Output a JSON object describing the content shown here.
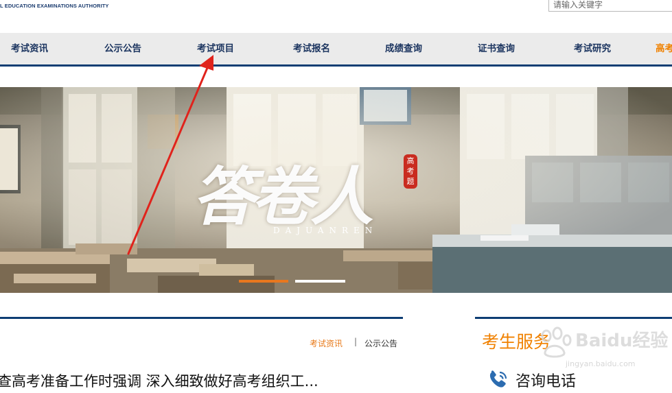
{
  "header": {
    "authority_text": "L EDUCATION EXAMINATIONS AUTHORITY",
    "search_placeholder": "请输入关键字"
  },
  "nav": {
    "items": [
      "考试资讯",
      "公示公告",
      "考试项目",
      "考试报名",
      "成绩查询",
      "证书查询",
      "考试研究",
      "高考"
    ],
    "highlighted_index": 7,
    "highlight_color": "#f08100",
    "bar_color": "#0d3d73"
  },
  "banner": {
    "title": "答卷人",
    "seal_text": "高考题",
    "subtitle": "DAJUANREN",
    "slide_indicators": {
      "count": 2,
      "active": 0,
      "active_color": "#e8771e"
    }
  },
  "news": {
    "tabs": [
      "考试资讯",
      "公示公告"
    ],
    "active_tab": 0,
    "separator": "|",
    "headline": "查高考准备工作时强调 深入细致做好高考组织工..."
  },
  "service": {
    "title": "考生服务",
    "items": [
      {
        "label": "咨询电话",
        "icon": "phone-icon"
      }
    ]
  },
  "watermark": {
    "text": "Baidu经验",
    "sub": "jingyan.baidu.com"
  },
  "annotation": {
    "icon": "red-arrow-icon",
    "color": "#e0231c"
  }
}
